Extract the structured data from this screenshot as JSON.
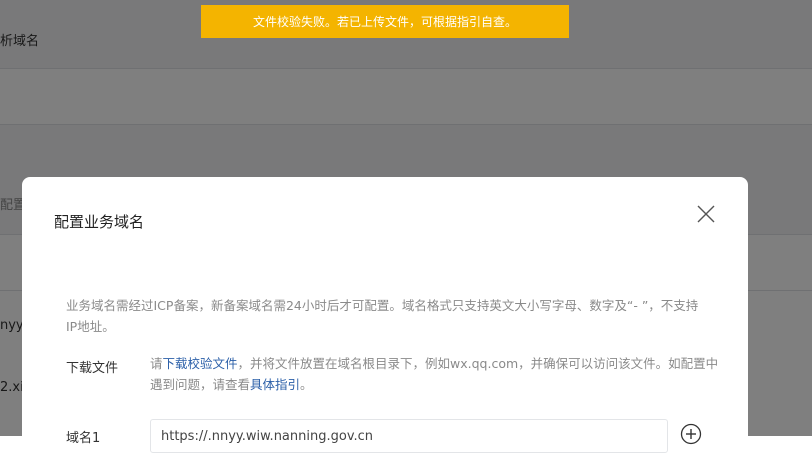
{
  "toast": {
    "message": "文件校验失败。若已上传文件，可根据指引自查。",
    "color": "#f4b400"
  },
  "background": {
    "heading": "析域名",
    "item_configure": "配置",
    "partial_1": "nyy",
    "partial_2": "2.xi"
  },
  "dialog": {
    "title": "配置业务域名",
    "notice": "业务域名需经过ICP备案，新备案域名需24小时后才可配置。域名格式只支持英文大小写字母、数字及“- ”，不支持IP地址。",
    "download": {
      "label": "下载文件",
      "text_before": "请",
      "link_label": "下载校验文件",
      "text_middle": "，并将文件放置在域名根目录下，例如wx.qq.com，并确保可以访问该文件。如配置中遇到问题，请查看",
      "guide_link": "具体指引",
      "text_end": "。"
    },
    "domain1": {
      "label": "域名1",
      "value": "https://.nnyy.wiw.nanning.gov.cn"
    }
  },
  "colors": {
    "link": "#2b5fa8",
    "overlay": "rgba(0,0,0,0.5)"
  }
}
